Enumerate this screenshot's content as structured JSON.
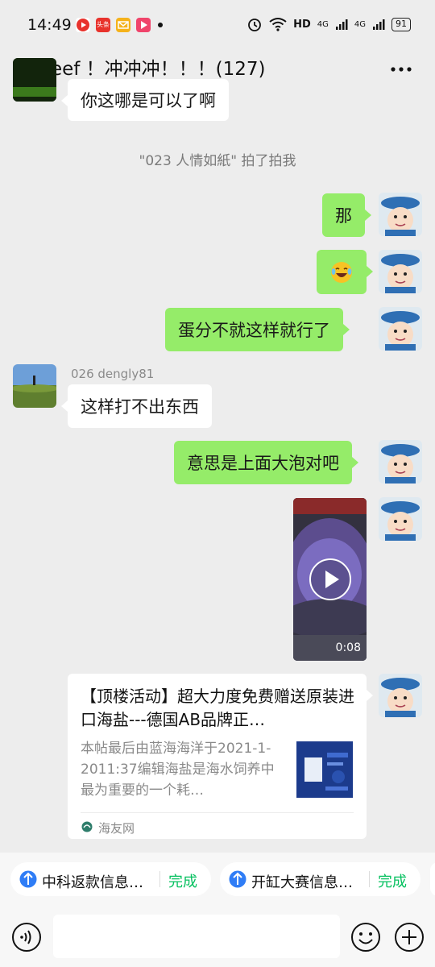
{
  "status_bar": {
    "time": "14:49",
    "battery": "91",
    "network_hd": "HD",
    "network_4g": "4G",
    "app_badge_text": "头条"
  },
  "header": {
    "title": "reef ！冲冲冲！！！(127)"
  },
  "messages": {
    "m1_text": "你这哪是可以了啊",
    "system_pat": "\"023 人情如紙\" 拍了拍我",
    "m2_text": "那",
    "m4_text": "蛋分不就这样就行了",
    "m5_sender": "026 dengly81",
    "m5_text": "这样打不出东西",
    "m6_text": "意思是上面大泡对吧",
    "video_duration": "0:08"
  },
  "link_card": {
    "title": "【顶楼活动】超大力度免费赠送原装进口海盐---德国AB品牌正…",
    "description": "本帖最后由蓝海海洋于2021-1-2011:37编辑海盐是海水饲养中最为重要的一个耗…",
    "source": "海友网"
  },
  "mini_programs": [
    {
      "label": "中科返款信息…",
      "done": "完成"
    },
    {
      "label": "开缸大赛信息…",
      "done": "完成"
    }
  ],
  "colors": {
    "background": "#ededed",
    "bubble_me": "#95ec69",
    "bubble_other": "#ffffff",
    "accent_green": "#07c160",
    "mini_program_blue": "#2f7df6"
  },
  "icons": {
    "back": "chevron-left-icon",
    "more": "more-dots-icon",
    "voice": "voice-icon",
    "emoji": "emoji-icon",
    "plus": "plus-icon",
    "play": "play-icon",
    "mini_program": "mini-program-icon"
  }
}
